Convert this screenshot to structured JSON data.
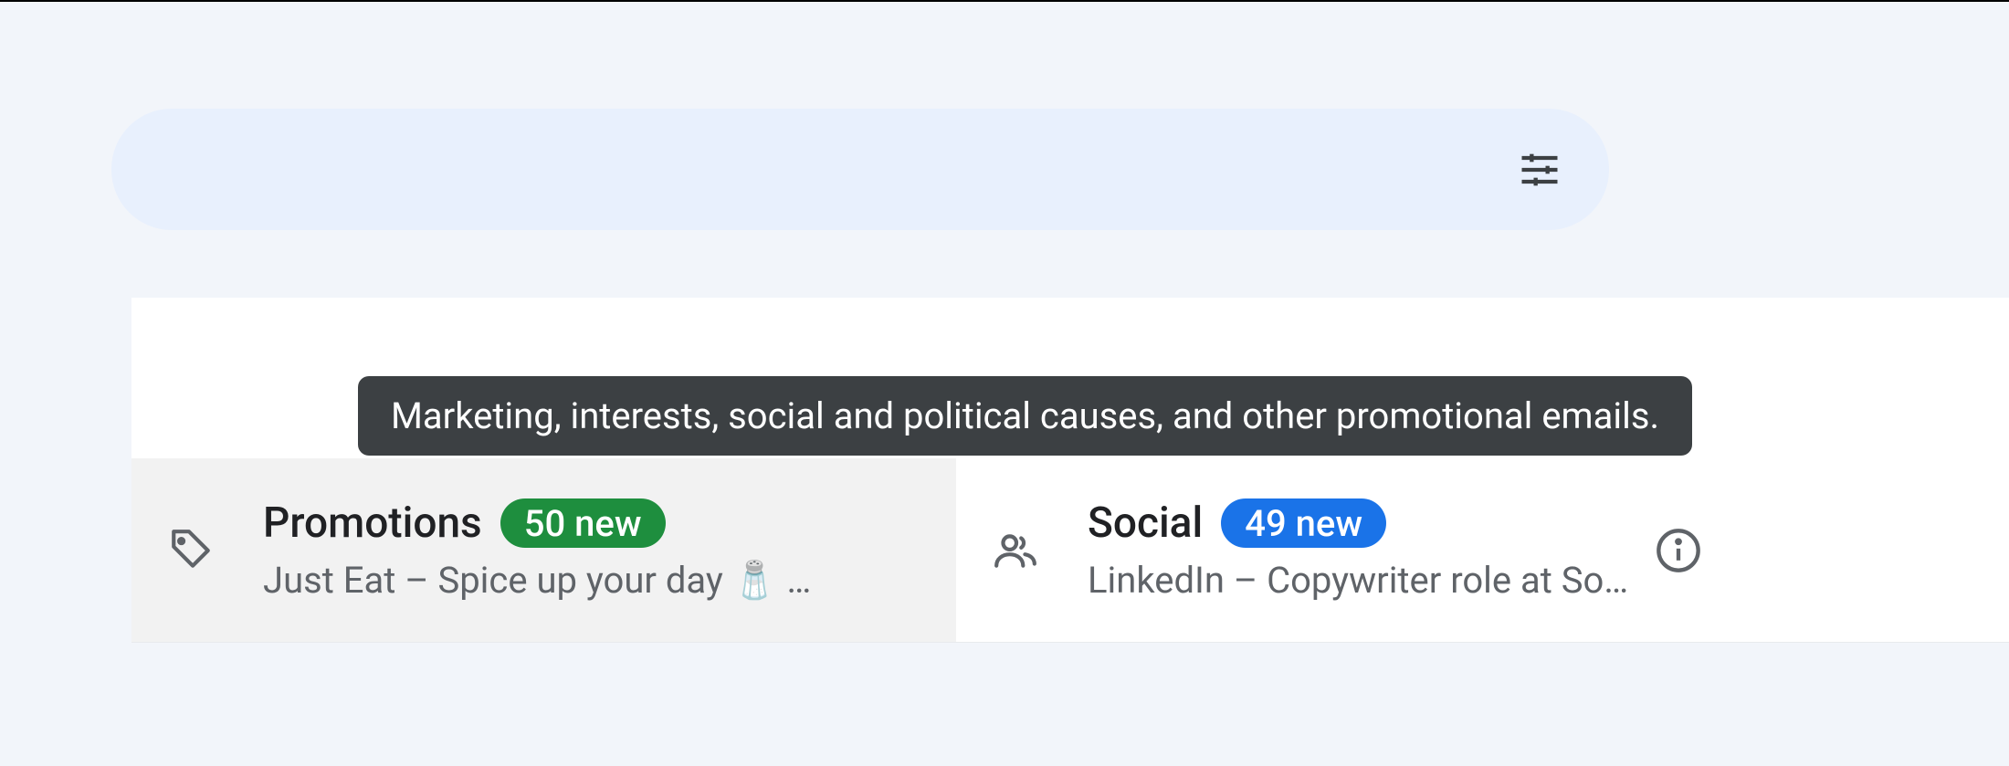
{
  "tooltip": {
    "text": "Marketing, interests, social and political causes, and other promotional emails."
  },
  "tabs": {
    "promotions": {
      "label": "Promotions",
      "badge": "50 new",
      "preview": "Just Eat – Spice up your day  🧂 …"
    },
    "social": {
      "label": "Social",
      "badge": "49 new",
      "preview": "LinkedIn – Copywriter role at So…"
    }
  }
}
